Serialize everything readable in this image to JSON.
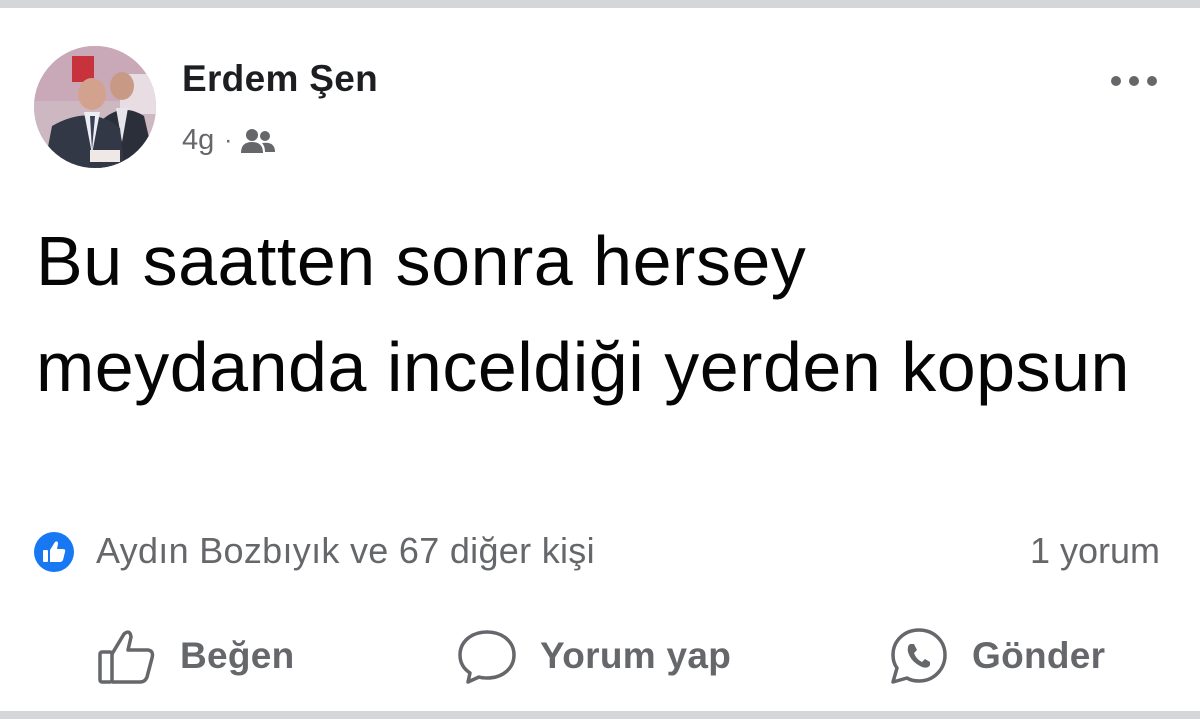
{
  "post": {
    "author": "Erdem Şen",
    "time": "4g",
    "separator": "·",
    "audience_icon": "friends-icon",
    "text": "Bu saatten sonra hersey meydanda inceldiği yerden kopsun",
    "more_icon": "more-dots-icon"
  },
  "reactions": {
    "icon": "like-badge-icon",
    "summary": "Aydın Bozbıyık ve 67 diğer kişi",
    "comments": "1 yorum"
  },
  "actions": {
    "like": {
      "label": "Beğen",
      "icon": "thumbs-up-icon"
    },
    "comment": {
      "label": "Yorum yap",
      "icon": "comment-bubble-icon"
    },
    "share": {
      "label": "Gönder",
      "icon": "whatsapp-icon"
    }
  },
  "colors": {
    "like_blue": "#1877f2",
    "secondary_text": "#65676b",
    "primary_text": "#050505"
  }
}
